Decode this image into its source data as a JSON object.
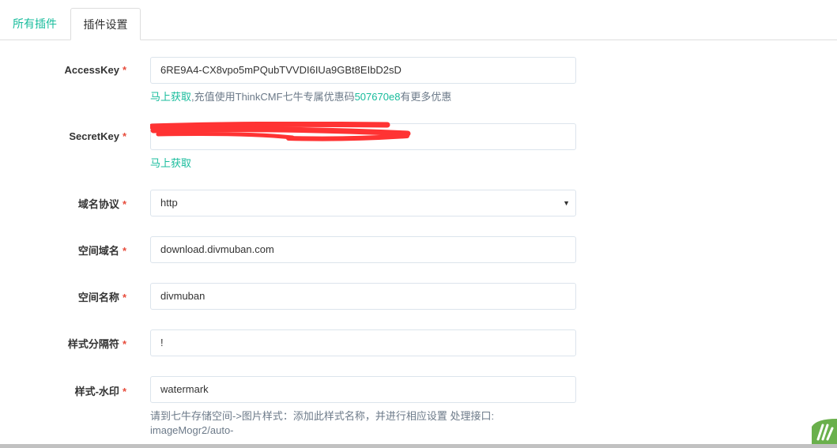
{
  "tabs": [
    {
      "label": "所有插件"
    },
    {
      "label": "插件设置"
    }
  ],
  "required_mark": "*",
  "form": {
    "access_key": {
      "label": "AccessKey",
      "value": "6RE9A4-CX8vpo5mPQubTVVDI6IUa9GBt8EIbD2sD",
      "help_link": "马上获取",
      "help_text1": ",充值使用ThinkCMF七牛专属优惠码",
      "help_code": "507670e8",
      "help_text2": "有更多优惠"
    },
    "secret_key": {
      "label": "SecretKey",
      "value": "",
      "help_link": "马上获取"
    },
    "protocol": {
      "label": "域名协议",
      "value": "http"
    },
    "domain": {
      "label": "空间域名",
      "value": "download.divmuban.com"
    },
    "bucket": {
      "label": "空间名称",
      "value": "divmuban"
    },
    "separator": {
      "label": "样式分隔符",
      "value": "!"
    },
    "watermark": {
      "label": "样式-水印",
      "value": "watermark",
      "help_line1": "请到七牛存储空间->图片样式：添加此样式名称，并进行相应设置 处理接口:",
      "help_line2": "imageMogr2/auto-"
    }
  },
  "colors": {
    "accent": "#18bc9c",
    "required": "#e74c3c",
    "redaction": "#ff3333"
  }
}
